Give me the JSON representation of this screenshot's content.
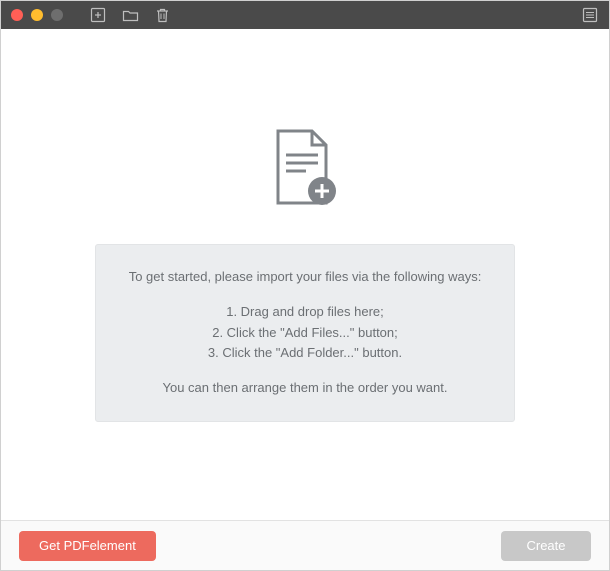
{
  "instructions": {
    "intro": "To get started, please import your files via the following ways:",
    "steps": [
      "1. Drag and drop files here;",
      "2. Click the \"Add Files...\" button;",
      "3. Click the \"Add Folder...\" button."
    ],
    "outro": "You can then arrange them in the order you want."
  },
  "footer": {
    "get_button": "Get PDFelement",
    "create_button": "Create"
  }
}
